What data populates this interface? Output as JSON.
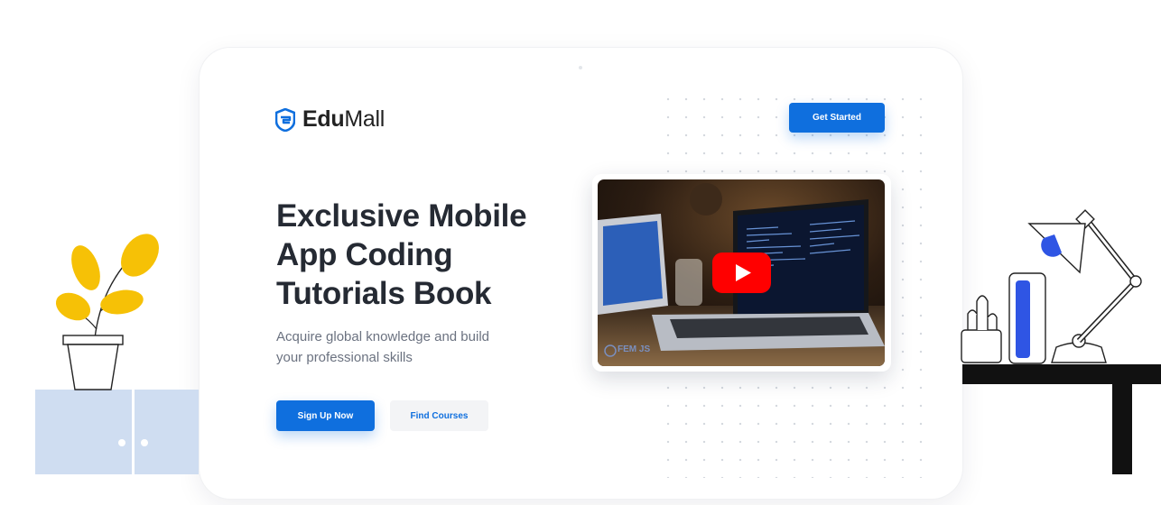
{
  "brand": {
    "name_bold": "Edu",
    "name_light": "Mall",
    "primary_color": "#0f6fde",
    "logo_icon": "shield-logo-icon"
  },
  "header": {
    "cta_label": "Get Started"
  },
  "hero": {
    "headline_lines": [
      "Exclusive Mobile",
      "App Coding",
      "Tutorials Book"
    ],
    "subtitle_lines": [
      "Acquire global knowledge and build",
      "your professional skills"
    ],
    "primary_button": "Sign Up Now",
    "secondary_button": "Find Courses"
  },
  "video": {
    "play_icon": "youtube-play-icon",
    "watermark": "FEM JS",
    "play_color": "#ff0000"
  }
}
